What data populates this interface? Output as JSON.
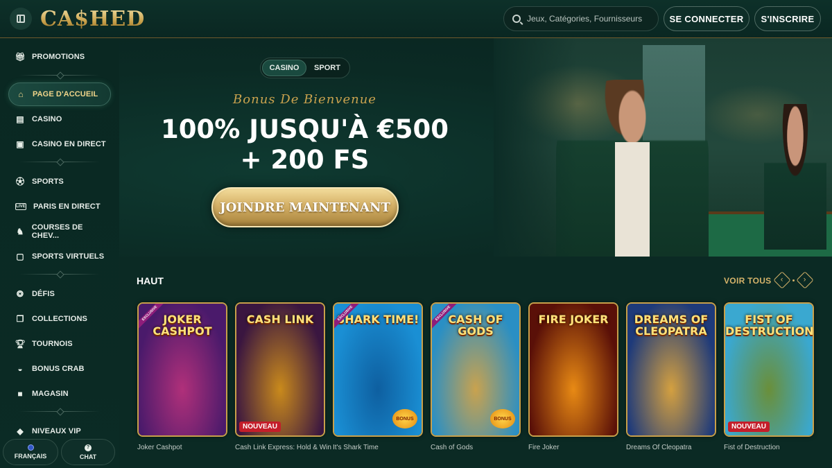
{
  "header": {
    "logo": "CA$HED",
    "search_placeholder": "Jeux, Catégories, Fournisseurs",
    "login_label": "SE CONNECTER",
    "register_label": "S'INSCRIRE"
  },
  "sidebar": {
    "items": [
      {
        "label": "PROMOTIONS",
        "icon": "gift-icon"
      },
      {
        "label": "PAGE D'ACCUEIL",
        "icon": "home-icon",
        "active": true
      },
      {
        "label": "CASINO",
        "icon": "slot-machine-icon"
      },
      {
        "label": "CASINO EN DIRECT",
        "icon": "live-cards-icon"
      },
      {
        "label": "SPORTS",
        "icon": "soccer-ball-icon"
      },
      {
        "label": "PARIS EN DIRECT",
        "icon": "live-badge-icon"
      },
      {
        "label": "COURSES DE CHEV...",
        "icon": "horse-icon"
      },
      {
        "label": "SPORTS VIRTUELS",
        "icon": "virtual-sports-icon"
      },
      {
        "label": "DÉFIS",
        "icon": "medal-icon"
      },
      {
        "label": "COLLECTIONS",
        "icon": "cards-icon"
      },
      {
        "label": "TOURNOIS",
        "icon": "trophy-icon"
      },
      {
        "label": "BONUS CRAB",
        "icon": "crab-icon"
      },
      {
        "label": "MAGASIN",
        "icon": "shopping-bag-icon"
      },
      {
        "label": "NIVEAUX VIP",
        "icon": "diamond-icon"
      }
    ],
    "language_label": "FRANÇAIS",
    "chat_label": "CHAT"
  },
  "hero": {
    "tab_casino": "CASINO",
    "tab_sport": "SPORT",
    "bonus_subtitle": "Bonus De Bienvenue",
    "bonus_line1": "100% JUSQU'À €500",
    "bonus_line2": "+ 200 FS",
    "cta_label": "JOINDRE MAINTENANT"
  },
  "games": {
    "section_title": "HAUT",
    "see_all_label": "VOIR TOUS",
    "exclusive_tag": "EXCLUSIVE",
    "new_tag": "NOUVEAU",
    "bonus_tag": "BONUS",
    "items": [
      {
        "caption": "Joker Cashpot",
        "art_title": "JOKER CASHPOT",
        "exclusive": true,
        "new": false,
        "bonus": false,
        "colors": [
          "#4a1a6b",
          "#b0307a"
        ]
      },
      {
        "caption": "Cash Link Express: Hold & Win",
        "art_title": "CASH LINK",
        "exclusive": false,
        "new": true,
        "bonus": false,
        "colors": [
          "#3a1640",
          "#c98a1c"
        ]
      },
      {
        "caption": "It's Shark Time",
        "art_title": "SHARK TIME!",
        "exclusive": true,
        "new": false,
        "bonus": true,
        "colors": [
          "#1a8fd4",
          "#0e5fa0"
        ]
      },
      {
        "caption": "Cash of Gods",
        "art_title": "CASH OF GODS",
        "exclusive": true,
        "new": false,
        "bonus": true,
        "colors": [
          "#2a8fc4",
          "#c9a24e"
        ]
      },
      {
        "caption": "Fire Joker",
        "art_title": "FIRE JOKER",
        "exclusive": false,
        "new": false,
        "bonus": false,
        "colors": [
          "#5a1008",
          "#e88a14"
        ]
      },
      {
        "caption": "Dreams Of Cleopatra",
        "art_title": "DREAMS OF CLEOPATRA",
        "exclusive": false,
        "new": false,
        "bonus": false,
        "colors": [
          "#1e3a7a",
          "#d4a040"
        ]
      },
      {
        "caption": "Fist of Destruction",
        "art_title": "FIST OF DESTRUCTION",
        "exclusive": false,
        "new": true,
        "bonus": false,
        "colors": [
          "#3aa8d0",
          "#6a8f3a"
        ]
      }
    ]
  }
}
